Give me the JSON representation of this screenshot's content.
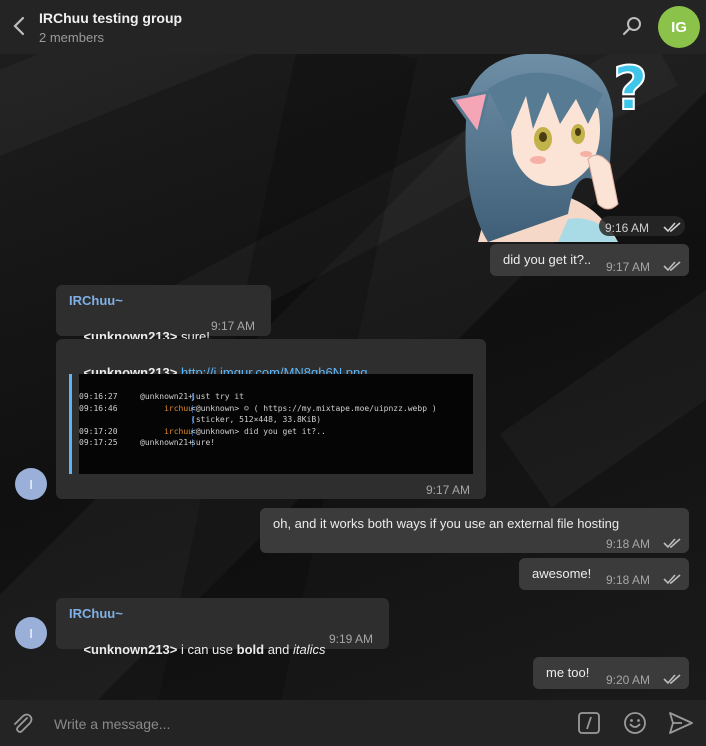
{
  "header": {
    "title": "IRChuu testing group",
    "subtitle": "2 members",
    "avatar_initials": "IG",
    "avatar_color": "#8bc34a"
  },
  "messages": {
    "sticker_time": "9:16 AM",
    "m1_text": "did you get it?..",
    "m1_time": "9:17 AM",
    "m2_sender": "IRChuu~",
    "m2_prefix": "<unknown213>",
    "m2_text": " sure!",
    "m2_time": "9:17 AM",
    "m3_prefix": "<unknown213>",
    "m3_link": "http://i.imgur.com/MN8qh6N.png",
    "m3_time": "9:17 AM",
    "avatar_in_initial": "I",
    "m4_text": "oh, and it works both ways if you use an external file hosting",
    "m4_time": "9:18 AM",
    "m5_text": "awesome!",
    "m5_time": "9:18 AM",
    "m6_sender": "IRChuu~",
    "m6_prefix": "<unknown213>",
    "m6_text_a": " i can use ",
    "m6_bold": "bold",
    "m6_text_b": " and ",
    "m6_italic": "italics",
    "m6_time": "9:19 AM",
    "m7_text": "me too!",
    "m7_time": "9:20 AM"
  },
  "preview": {
    "rows": [
      {
        "time": "09:16:27",
        "nick": "@unknown21+",
        "sep": "|",
        "msg": "just try it"
      },
      {
        "time": "09:16:46",
        "nick": "irchuu",
        "sep": "|",
        "msg": "<@unknown> ☺ ( https://my.mixtape.moe/uipnzz.webp )"
      },
      {
        "time": "",
        "nick": "",
        "sep": "|",
        "msg": "(sticker, 512×448, 33.8KiB)"
      },
      {
        "time": "09:17:20",
        "nick": "irchuu",
        "sep": "|",
        "msg": "<@unknown> did you get it?.."
      },
      {
        "time": "09:17:25",
        "nick": "@unknown21+",
        "sep": "|",
        "msg": "sure!"
      }
    ]
  },
  "composer": {
    "placeholder": "Write a message..."
  },
  "icons": {
    "back": "chevron-left-icon",
    "search": "search-icon",
    "attach": "paperclip-icon",
    "commands": "slash-command-icon",
    "emoji": "smiley-icon",
    "send": "send-arrow-icon"
  }
}
